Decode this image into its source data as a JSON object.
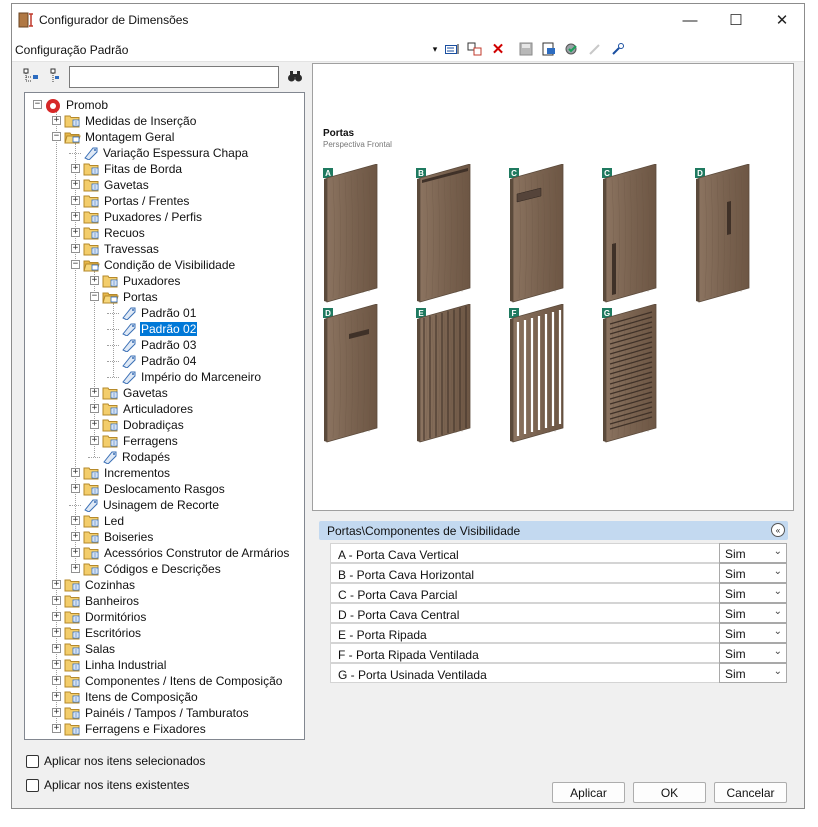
{
  "window": {
    "title": "Configurador de Dimensões",
    "controls": {
      "minimize": "—",
      "maximize": "☐",
      "close": "✕"
    }
  },
  "config_bar": {
    "label": "Configuração Padrão",
    "dropdown_arrow": "▾"
  },
  "search": {
    "value": "",
    "icon": "binoculars-icon"
  },
  "tree": [
    {
      "label": "Promob",
      "level": 0,
      "type": "root",
      "expander": "minus"
    },
    {
      "label": "Medidas de Inserção",
      "level": 1,
      "type": "folder",
      "expander": "plus"
    },
    {
      "label": "Montagem Geral",
      "level": 1,
      "type": "folder-open",
      "expander": "minus"
    },
    {
      "label": "Variação Espessura Chapa",
      "level": 2,
      "type": "tag",
      "expander": "none"
    },
    {
      "label": "Fitas de Borda",
      "level": 2,
      "type": "folder",
      "expander": "plus"
    },
    {
      "label": "Gavetas",
      "level": 2,
      "type": "folder",
      "expander": "plus"
    },
    {
      "label": "Portas / Frentes",
      "level": 2,
      "type": "folder",
      "expander": "plus"
    },
    {
      "label": "Puxadores / Perfis",
      "level": 2,
      "type": "folder",
      "expander": "plus"
    },
    {
      "label": "Recuos",
      "level": 2,
      "type": "folder",
      "expander": "plus"
    },
    {
      "label": "Travessas",
      "level": 2,
      "type": "folder",
      "expander": "plus"
    },
    {
      "label": "Condição de Visibilidade",
      "level": 2,
      "type": "folder-open",
      "expander": "minus"
    },
    {
      "label": "Puxadores",
      "level": 3,
      "type": "folder",
      "expander": "plus"
    },
    {
      "label": "Portas",
      "level": 3,
      "type": "folder-open",
      "expander": "minus"
    },
    {
      "label": "Padrão 01",
      "level": 4,
      "type": "tag",
      "expander": "none"
    },
    {
      "label": "Padrão 02",
      "level": 4,
      "type": "tag",
      "expander": "none",
      "selected": true
    },
    {
      "label": "Padrão 03",
      "level": 4,
      "type": "tag",
      "expander": "none"
    },
    {
      "label": "Padrão 04",
      "level": 4,
      "type": "tag",
      "expander": "none"
    },
    {
      "label": "Império do Marceneiro",
      "level": 4,
      "type": "tag",
      "expander": "none"
    },
    {
      "label": "Gavetas",
      "level": 3,
      "type": "folder",
      "expander": "plus"
    },
    {
      "label": "Articuladores",
      "level": 3,
      "type": "folder",
      "expander": "plus"
    },
    {
      "label": "Dobradiças",
      "level": 3,
      "type": "folder",
      "expander": "plus"
    },
    {
      "label": "Ferragens",
      "level": 3,
      "type": "folder",
      "expander": "plus"
    },
    {
      "label": "Rodapés",
      "level": 3,
      "type": "tag",
      "expander": "none"
    },
    {
      "label": "Incrementos",
      "level": 2,
      "type": "folder",
      "expander": "plus"
    },
    {
      "label": "Deslocamento Rasgos",
      "level": 2,
      "type": "folder",
      "expander": "plus"
    },
    {
      "label": "Usinagem de Recorte",
      "level": 2,
      "type": "tag",
      "expander": "none"
    },
    {
      "label": "Led",
      "level": 2,
      "type": "folder",
      "expander": "plus"
    },
    {
      "label": "Boiseries",
      "level": 2,
      "type": "folder",
      "expander": "plus"
    },
    {
      "label": "Acessórios Construtor de Armários",
      "level": 2,
      "type": "folder",
      "expander": "plus"
    },
    {
      "label": "Códigos e Descrições",
      "level": 2,
      "type": "folder",
      "expander": "plus"
    },
    {
      "label": "Cozinhas",
      "level": 1,
      "type": "folder",
      "expander": "plus"
    },
    {
      "label": "Banheiros",
      "level": 1,
      "type": "folder",
      "expander": "plus"
    },
    {
      "label": "Dormitórios",
      "level": 1,
      "type": "folder",
      "expander": "plus"
    },
    {
      "label": "Escritórios",
      "level": 1,
      "type": "folder",
      "expander": "plus"
    },
    {
      "label": "Salas",
      "level": 1,
      "type": "folder",
      "expander": "plus"
    },
    {
      "label": "Linha Industrial",
      "level": 1,
      "type": "folder",
      "expander": "plus"
    },
    {
      "label": "Componentes / Itens de Composição",
      "level": 1,
      "type": "folder",
      "expander": "plus"
    },
    {
      "label": "Itens de Composição",
      "level": 1,
      "type": "folder",
      "expander": "plus"
    },
    {
      "label": "Painéis / Tampos / Tamburatos",
      "level": 1,
      "type": "folder",
      "expander": "plus"
    },
    {
      "label": "Ferragens e Fixadores",
      "level": 1,
      "type": "folder",
      "expander": "plus"
    }
  ],
  "preview": {
    "title": "Portas",
    "subtitle": "Perspectiva Frontal",
    "doors": [
      {
        "label": "A",
        "style": "plain"
      },
      {
        "label": "B",
        "style": "cava-horizontal"
      },
      {
        "label": "C",
        "style": "cava-parcial"
      },
      {
        "label": "C",
        "style": "cava-vertical"
      },
      {
        "label": "D",
        "style": "cava-central"
      },
      {
        "label": "D",
        "style": "cava-central-top"
      },
      {
        "label": "E",
        "style": "ripada"
      },
      {
        "label": "F",
        "style": "ripada-ventilada"
      },
      {
        "label": "G",
        "style": "usinada-ventilada"
      }
    ]
  },
  "properties": {
    "header": "Portas\\Componentes de Visibilidade",
    "collapse_icon": "«",
    "rows": [
      {
        "name": "A - Porta Cava Vertical",
        "value": "Sim"
      },
      {
        "name": "B - Porta Cava Horizontal",
        "value": "Sim"
      },
      {
        "name": "C - Porta Cava Parcial",
        "value": "Sim"
      },
      {
        "name": "D - Porta Cava Central",
        "value": "Sim"
      },
      {
        "name": "E - Porta Ripada",
        "value": "Sim"
      },
      {
        "name": "F - Porta Ripada Ventilada",
        "value": "Sim"
      },
      {
        "name": "G - Porta Usinada Ventilada",
        "value": "Sim"
      }
    ]
  },
  "options": {
    "apply_selected": "Aplicar nos itens selecionados",
    "apply_existing": "Aplicar nos itens existentes"
  },
  "buttons": {
    "apply": "Aplicar",
    "ok": "OK",
    "cancel": "Cancelar"
  },
  "colors": {
    "wood": "#7a6350",
    "wood_dark": "#5b4a3b",
    "accent_green": "#1f7a60",
    "selection": "#0078d7",
    "header_blue": "#c3d9f0"
  }
}
